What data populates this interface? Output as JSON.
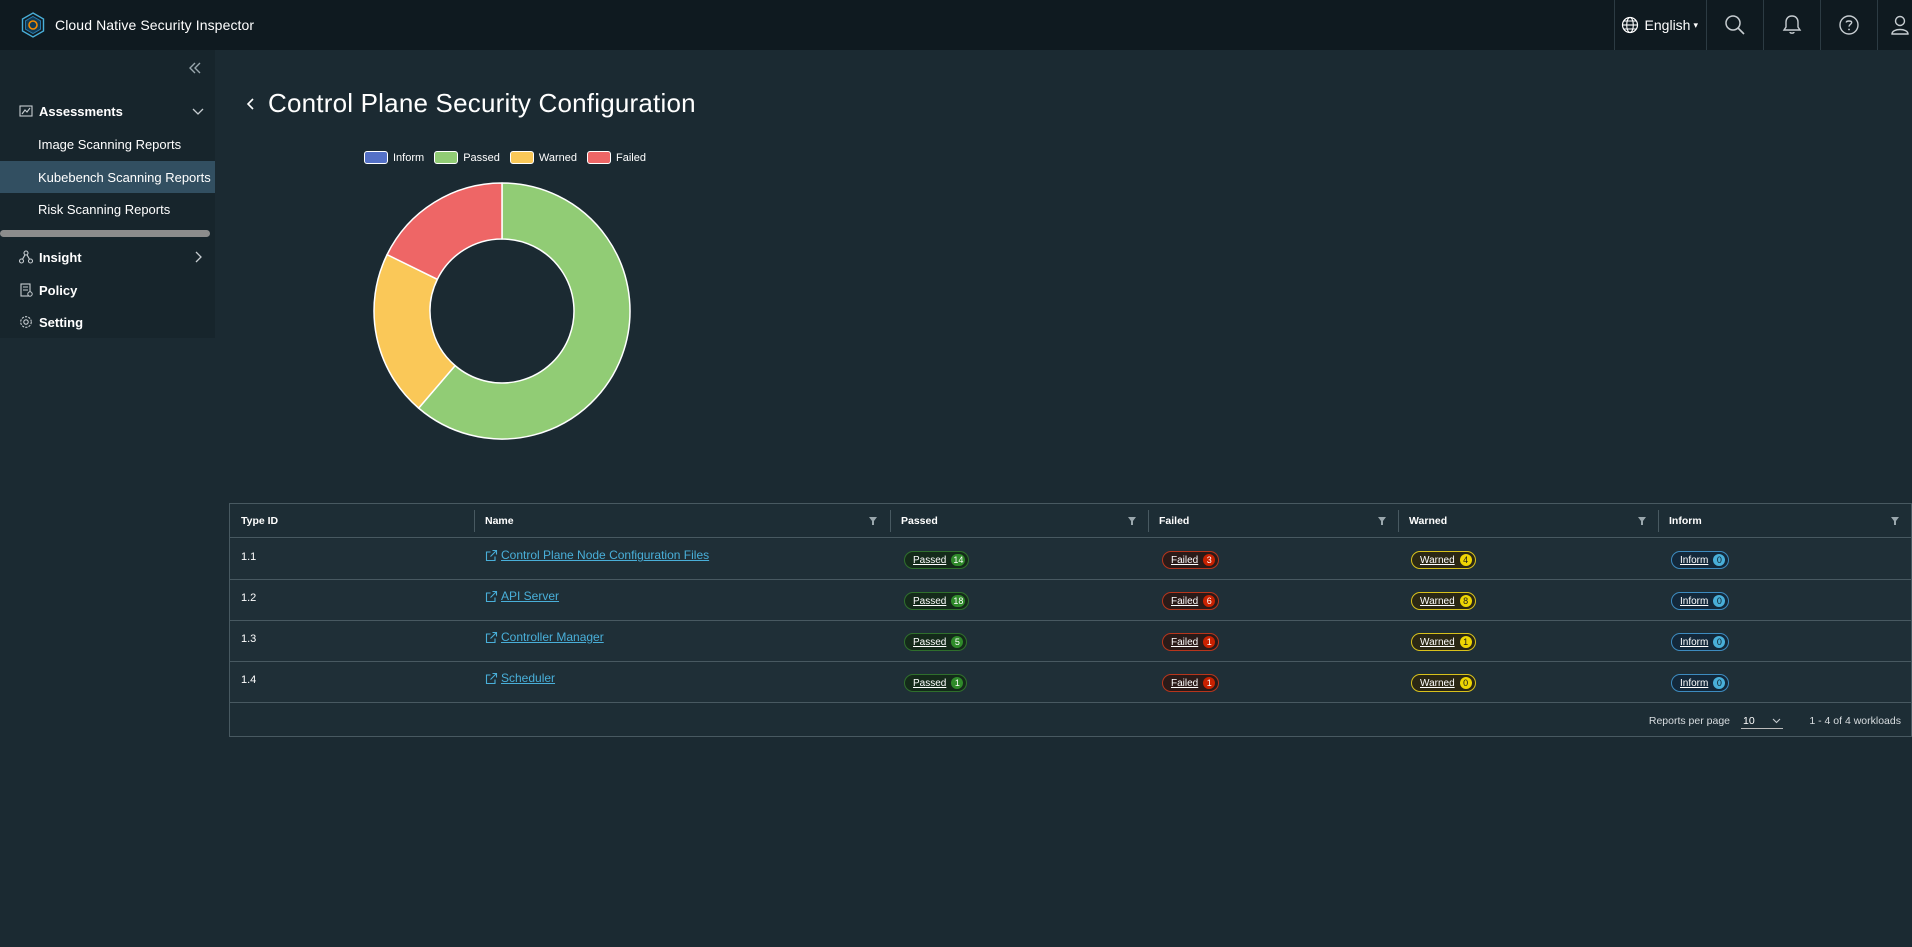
{
  "app": {
    "title": "Cloud Native Security Inspector",
    "language": "English"
  },
  "header": {
    "icons": [
      "search-icon",
      "bell-icon",
      "help-icon",
      "user-icon"
    ]
  },
  "sidebar": {
    "groups": [
      {
        "label": "Assessments",
        "icon": "chart-icon",
        "expanded": true
      },
      {
        "label": "Insight",
        "icon": "network-icon",
        "expanded": false
      },
      {
        "label": "Policy",
        "icon": "policy-icon"
      },
      {
        "label": "Setting",
        "icon": "gear-icon"
      }
    ],
    "assessment_items": [
      {
        "label": "Image Scanning Reports",
        "active": false
      },
      {
        "label": "Kubebench Scanning Reports",
        "active": true
      },
      {
        "label": "Risk Scanning Reports",
        "active": false
      }
    ]
  },
  "page": {
    "title": "Control Plane Security Configuration"
  },
  "chart_data": {
    "type": "pie",
    "variant": "donut",
    "labels": [
      "Inform",
      "Passed",
      "Warned",
      "Failed"
    ],
    "values": [
      0,
      38,
      13,
      11
    ],
    "colors": [
      "#5470c6",
      "#91cc75",
      "#fac858",
      "#ee6666"
    ],
    "legend": "top"
  },
  "table": {
    "columns": [
      "Type ID",
      "Name",
      "Passed",
      "Failed",
      "Warned",
      "Inform"
    ],
    "rows": [
      {
        "type_id": "1.1",
        "name": "Control Plane Node Configuration Files",
        "passed": "14",
        "failed": "3",
        "warned": "4",
        "inform": "0"
      },
      {
        "type_id": "1.2",
        "name": "API Server",
        "passed": "18",
        "failed": "6",
        "warned": "8",
        "inform": "0"
      },
      {
        "type_id": "1.3",
        "name": "Controller Manager",
        "passed": "5",
        "failed": "1",
        "warned": "1",
        "inform": "0"
      },
      {
        "type_id": "1.4",
        "name": "Scheduler",
        "passed": "1",
        "failed": "1",
        "warned": "0",
        "inform": "0"
      }
    ],
    "badge_labels": {
      "passed": "Passed",
      "failed": "Failed",
      "warned": "Warned",
      "inform": "Inform"
    },
    "footer": {
      "per_page_label": "Reports per page",
      "per_page_value": "10",
      "range_text": "1 - 4 of 4 workloads"
    }
  }
}
